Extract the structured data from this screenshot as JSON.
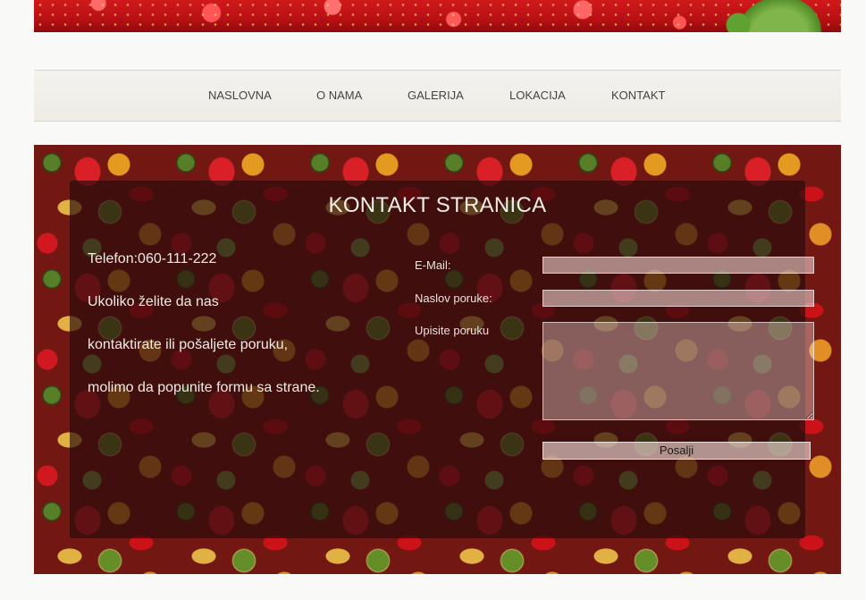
{
  "header": {
    "banner_icon": "strawberry-banner"
  },
  "nav": {
    "items": [
      {
        "label": "NASLOVNA"
      },
      {
        "label": "O NAMA"
      },
      {
        "label": "GALERIJA"
      },
      {
        "label": "LOKACIJA"
      },
      {
        "label": "KONTAKT"
      }
    ]
  },
  "contact": {
    "title": "KONTAKT STRANICA",
    "info_lines": [
      "Telefon:060-111-222",
      "Ukoliko želite da nas",
      "kontaktirate ili pošaljete poruku,",
      "molimo da popunite formu sa strane."
    ],
    "form": {
      "email_label": "E-Mail:",
      "email_value": "",
      "subject_label": "Naslov poruke:",
      "subject_value": "",
      "message_label": "Upisite poruku",
      "message_value": "",
      "submit_label": "Posalji"
    }
  },
  "colors": {
    "page_bg": "#f9f9f8",
    "nav_text": "#444444",
    "overlay": "#280a0c",
    "content_text": "#f0ebe4"
  }
}
